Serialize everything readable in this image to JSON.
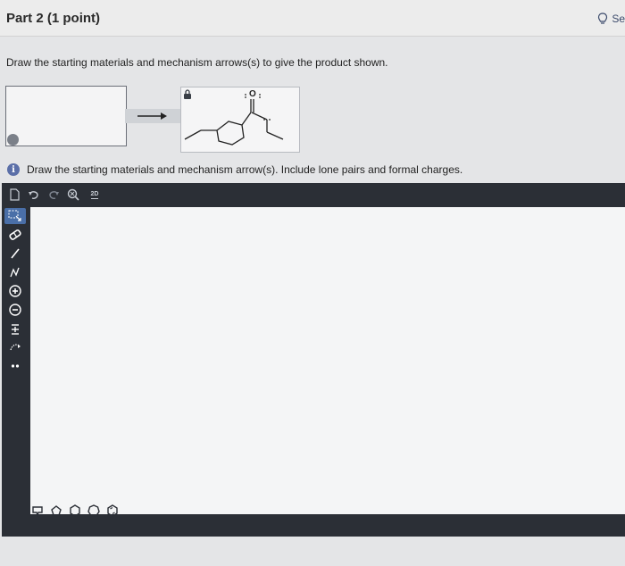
{
  "header": {
    "part_title": "Part 2",
    "points": "(1 point)",
    "hint_label": "Se"
  },
  "question": {
    "prompt": "Draw the starting materials and mechanism arrows(s) to give the product shown.",
    "instruction": "Draw the starting materials and mechanism arrow(s). Include lone pairs and formal charges.",
    "product_atom": "O"
  },
  "editor": {
    "top_tools": [
      "file-icon",
      "undo-icon",
      "redo-icon",
      "zoom-icon",
      "2d-icon"
    ],
    "zoom_label": "2D",
    "left_tools": [
      "select-icon",
      "eraser-icon",
      "bond-icon",
      "chain-icon",
      "plus-charge-icon",
      "minus-charge-icon",
      "plus-minus-icon",
      "arrow-icon",
      "lone-pair-icon"
    ],
    "bottom_tools": [
      "template-icon",
      "pentagon-icon",
      "hexagon-icon",
      "heptagon-icon",
      "cyclo-icon"
    ]
  },
  "colors": {
    "header_bg": "#ececec",
    "editor_frame": "#2b2f36",
    "canvas_bg": "#f4f5f6",
    "accent": "#4a6fa8",
    "info_icon": "#5b6fa8"
  }
}
